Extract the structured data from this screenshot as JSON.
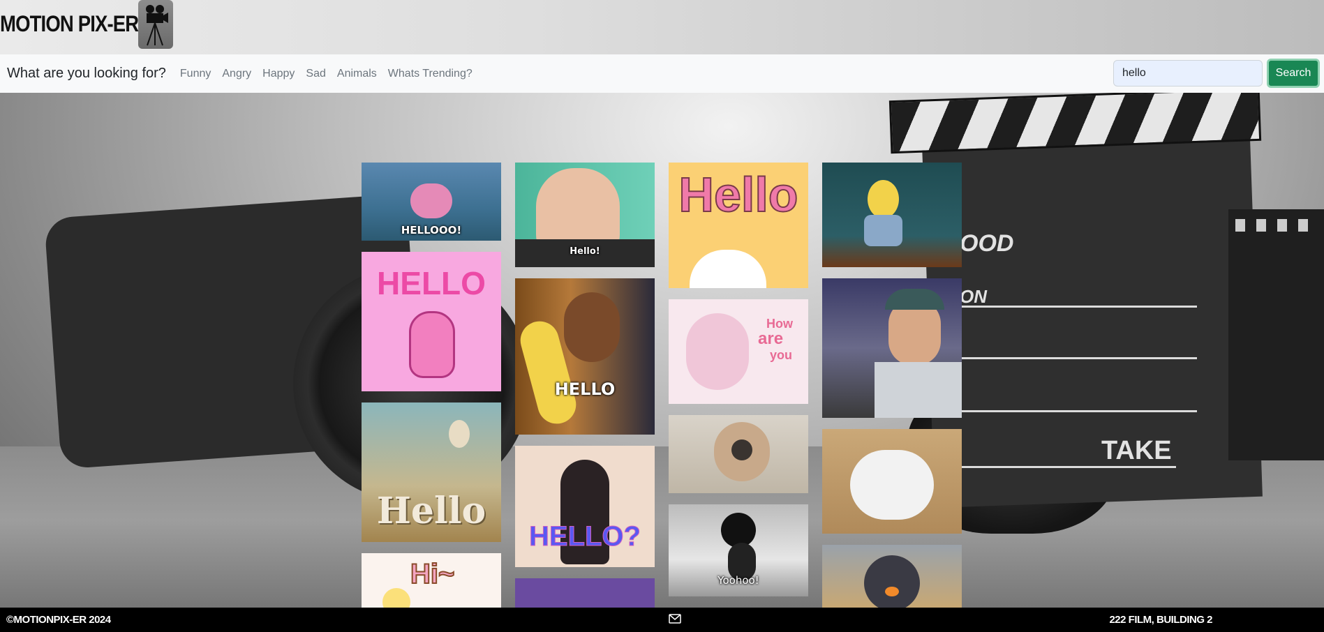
{
  "brand": {
    "name": "MOTION PIX-ER",
    "logo_icon": "film-camera-icon"
  },
  "nav": {
    "title": "What are you looking for?",
    "links": [
      "Funny",
      "Angry",
      "Happy",
      "Sad",
      "Animals",
      "Whats Trending?"
    ]
  },
  "search": {
    "value": "hello",
    "button_label": "Search"
  },
  "gifs": {
    "captions": [
      "HELLOOO!",
      "HELLO",
      "Hello",
      "Hello!",
      "HELLO",
      "HELLO?",
      "Hello",
      "How",
      "are",
      "you",
      "Yoohoo!",
      "Hi~"
    ]
  },
  "background": {
    "clapper_text_1": "OOD",
    "clapper_text_2": "ON",
    "clapper_text_3": "TAKE"
  },
  "footer": {
    "copyright": "©MOTIONPIX-ER 2024",
    "mail_icon": "envelope-icon",
    "address": "222 FILM, BUILDING 2"
  },
  "colors": {
    "search_button": "#198754",
    "navbar": "#f8f9fa",
    "footer": "#000000"
  }
}
